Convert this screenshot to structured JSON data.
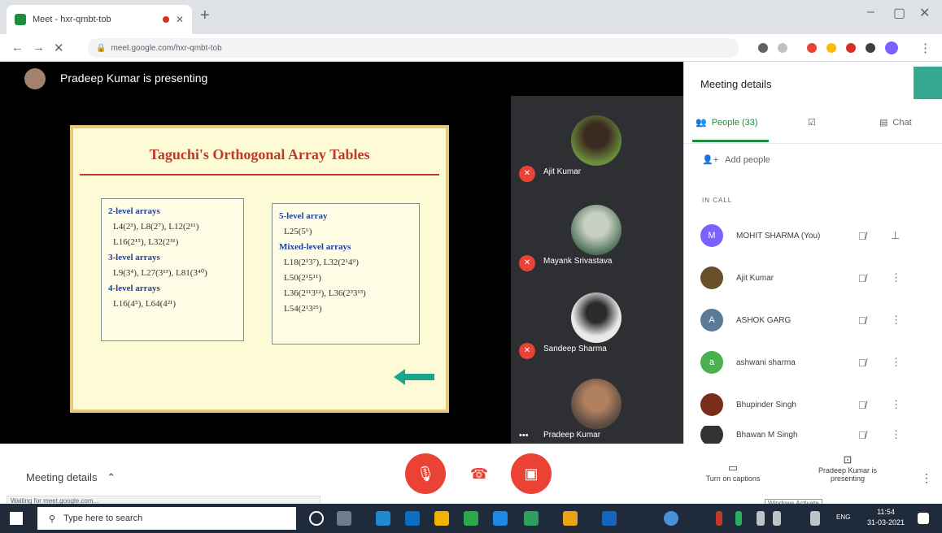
{
  "browser": {
    "tab_title": "Meet - hxr-qmbt-tob",
    "new_tab": "+",
    "url": "meet.google.com/hxr-qmbt-tob"
  },
  "presenter": {
    "label": "Pradeep Kumar is presenting"
  },
  "slide": {
    "title": "Taguchi's Orthogonal Array Tables",
    "left_box": [
      {
        "head": "2-level arrays",
        "items": [
          "L4(2³), L8(2⁷), L12(2¹¹)",
          "L16(2¹⁵), L32(2³¹)"
        ]
      },
      {
        "head": "3-level arrays",
        "items": [
          "L9(3⁴), L27(3¹³), L81(3⁴⁰)"
        ]
      },
      {
        "head": "4-level arrays",
        "items": [
          "L16(4⁵), L64(4²¹)"
        ]
      }
    ],
    "right_box": [
      {
        "head": "5-level array",
        "items": [
          "L25(5⁶)"
        ]
      },
      {
        "head": "Mixed-level arrays",
        "items": [
          "L18(2¹3⁷), L32(2¹4⁹)",
          "L50(2¹5¹¹)",
          "L36(2¹¹3¹²), L36(2³3¹³)",
          "L54(2¹3²⁵)"
        ]
      }
    ]
  },
  "participants_strip": [
    {
      "name": "Ajit Kumar",
      "muted": true
    },
    {
      "name": "Mayank Srivastava",
      "muted": true
    },
    {
      "name": "Sandeep Sharma",
      "muted": true
    },
    {
      "name": "Pradeep Kumar",
      "muted": false
    }
  ],
  "panel": {
    "title": "Meeting details",
    "tab_people": "People (33)",
    "tab_chat": "Chat",
    "add_people": "Add people",
    "in_call": "IN CALL",
    "people": [
      {
        "name": "MOHIT SHARMA (You)",
        "initial": "M",
        "color": "#7b61ff"
      },
      {
        "name": "Ajit Kumar",
        "initial": "",
        "color": "#6b4f2a"
      },
      {
        "name": "ASHOK GARG",
        "initial": "A",
        "color": "#5b7a99"
      },
      {
        "name": "ashwani sharma",
        "initial": "a",
        "color": "#4caf50"
      },
      {
        "name": "Bhupinder Singh",
        "initial": "",
        "color": "#7a2d1a"
      },
      {
        "name": "Bhawan M Singh",
        "initial": "",
        "color": "#333333"
      }
    ]
  },
  "controls": {
    "meeting_details": "Meeting details",
    "captions": "Turn on captions",
    "presenting": "Pradeep Kumar is presenting",
    "status": "Waiting for meet.google.com...",
    "activate": "Windows Activate"
  },
  "taskbar": {
    "search_placeholder": "Type here to search",
    "time": "11:54",
    "date": "31-03-2021",
    "lang": "ENG"
  }
}
